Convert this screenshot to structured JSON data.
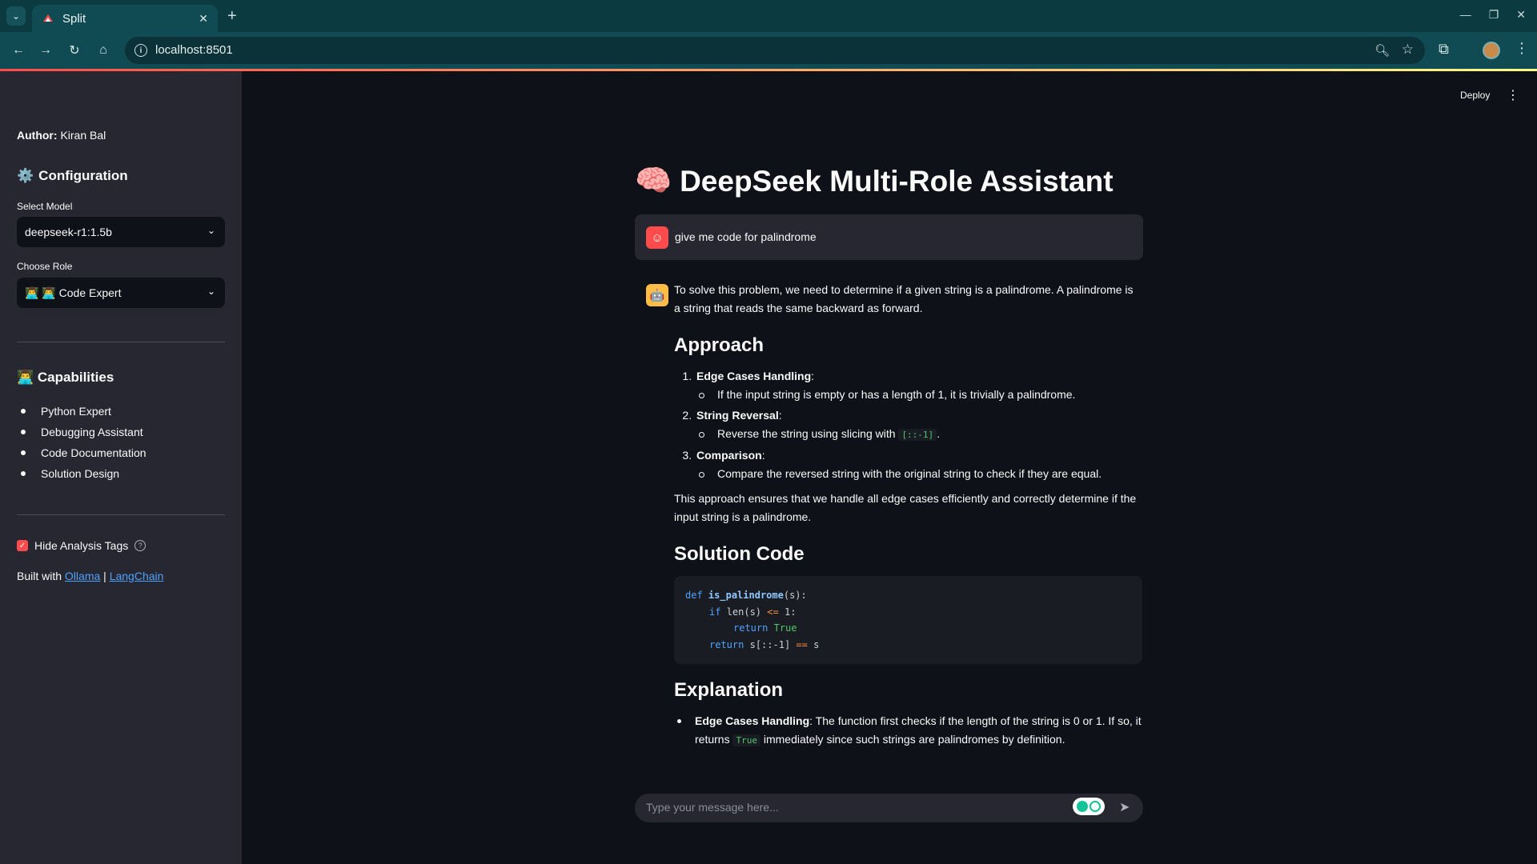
{
  "browser": {
    "tab_title": "Split",
    "url": "localhost:8501",
    "new_tab_label": "+",
    "tab_close_label": "✕"
  },
  "header": {
    "deploy_label": "Deploy"
  },
  "sidebar": {
    "author_label": "Author:",
    "author_name": "Kiran Bal",
    "config_heading": "Configuration",
    "model_label": "Select Model",
    "model_value": "deepseek-r1:1.5b",
    "role_label": "Choose Role",
    "role_value": "👨‍💻 👨‍💻 Code Expert",
    "capabilities_heading": "👨‍💻 Capabilities",
    "capabilities": [
      "Python Expert",
      "Debugging Assistant",
      "Code Documentation",
      "Solution Design"
    ],
    "hide_tags_label": "Hide Analysis Tags",
    "hide_tags_checked": true,
    "built_with_prefix": "Built with",
    "built_with_sep": "|",
    "link_ollama": "Ollama",
    "link_langchain": "LangChain"
  },
  "main": {
    "title_emoji": "🧠",
    "title": "DeepSeek Multi-Role Assistant",
    "user_message": "give me code for palindrome",
    "bot": {
      "intro": "To solve this problem, we need to determine if a given string is a palindrome. A palindrome is a string that reads the same backward as forward.",
      "approach_heading": "Approach",
      "steps": [
        {
          "title": "Edge Cases Handling",
          "detail": "If the input string is empty or has a length of 1, it is trivially a palindrome."
        },
        {
          "title": "String Reversal",
          "detail": "Reverse the string using slicing with",
          "code": "[::-1]",
          "detail_suffix": "."
        },
        {
          "title": "Comparison",
          "detail": "Compare the reversed string with the original string to check if they are equal."
        }
      ],
      "approach_summary": "This approach ensures that we handle all edge cases efficiently and correctly determine if the input string is a palindrome.",
      "solution_heading": "Solution Code",
      "code_lines": {
        "l1_kw": "def",
        "l1_fn": "is_palindrome",
        "l1_rest": "(s):",
        "l2_kw": "if",
        "l2_a": "len(s)",
        "l2_op": "<=",
        "l2_b": "1:",
        "l3_kw": "return",
        "l3_val": "True",
        "l4_kw": "return",
        "l4_a": "s[::-1]",
        "l4_op": "==",
        "l4_b": "s"
      },
      "explanation_heading": "Explanation",
      "explanation_title": "Edge Cases Handling",
      "explanation_text_a": ": The function first checks if the length of the string is 0 or 1. If so, it returns",
      "explanation_code": "True",
      "explanation_text_b": "immediately since such strings are palindromes by definition."
    },
    "input_placeholder": "Type your message here..."
  },
  "colors": {
    "accent": "#ff4b4b",
    "sidebar_bg": "#262730",
    "main_bg": "#0e1117",
    "link": "#4ea1ff"
  }
}
